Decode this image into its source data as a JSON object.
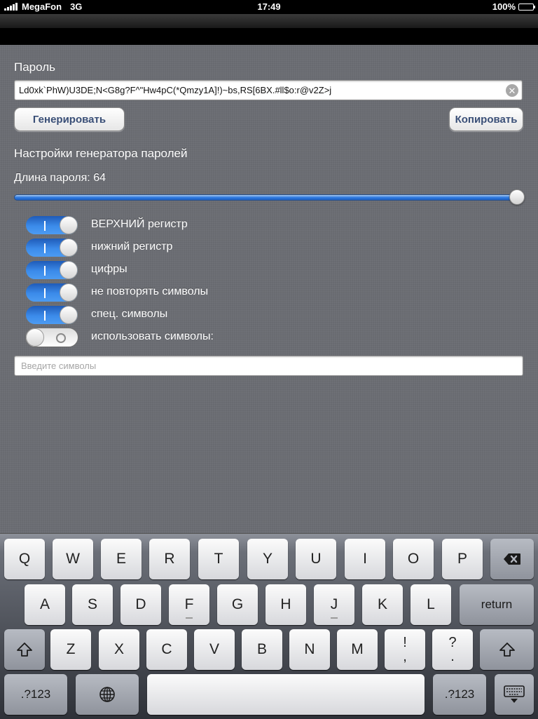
{
  "status": {
    "carrier": "MegaFon",
    "network": "3G",
    "time": "17:49",
    "battery": "100%"
  },
  "form": {
    "password_label": "Пароль",
    "password_value": "Ld0xk`PhW)U3DE;N<G8g?F^\"Hw4pC(*Qmzy1A]!)~bs,RS[6BX.#ll$o:r@v2Z>j",
    "generate_label": "Генерировать",
    "copy_label": "Копировать",
    "settings_title": "Настройки генератора паролей",
    "length_label": "Длина пароля: 64",
    "length_fraction": 1.0,
    "options": [
      {
        "label": "ВЕРХНИЙ регистр",
        "on": true
      },
      {
        "label": "нижний регистр",
        "on": true
      },
      {
        "label": "цифры",
        "on": true
      },
      {
        "label": "не повторять символы",
        "on": true
      },
      {
        "label": "спец. символы",
        "on": true
      },
      {
        "label": "использовать символы:",
        "on": false
      }
    ],
    "symbols_placeholder": "Введите символы"
  },
  "keyboard": {
    "row1": [
      "Q",
      "W",
      "E",
      "R",
      "T",
      "Y",
      "U",
      "I",
      "O",
      "P"
    ],
    "row2": [
      "A",
      "S",
      "D",
      "F",
      "G",
      "H",
      "J",
      "K",
      "L"
    ],
    "row3": [
      "Z",
      "X",
      "C",
      "V",
      "B",
      "N",
      "M"
    ],
    "return_label": "return",
    "excl_top": "!",
    "excl_bottom": ",",
    "quest_top": "?",
    "quest_bottom": ".",
    "numbers_label": ".?123",
    "icons": {
      "backspace": "backspace-icon",
      "shift": "shift-icon",
      "globe": "globe-icon",
      "hide_keyboard": "hide-keyboard-icon",
      "clear": "clear-icon"
    }
  }
}
